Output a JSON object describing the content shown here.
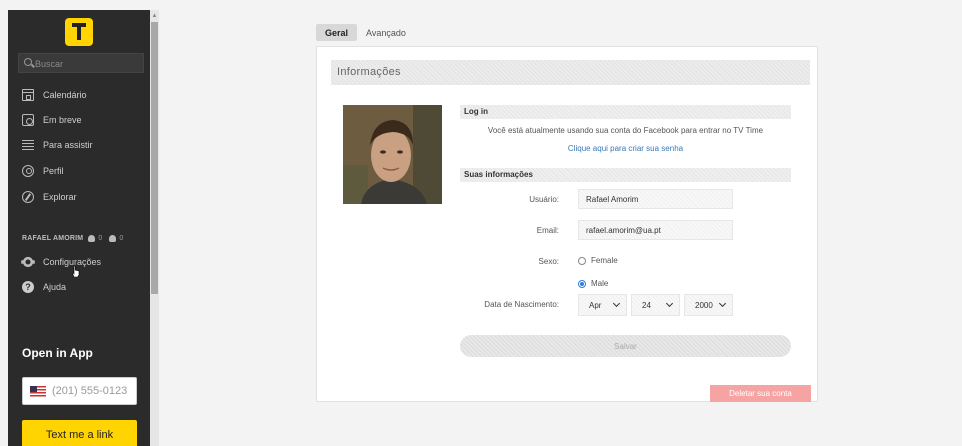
{
  "sidebar": {
    "search_placeholder": "Buscar",
    "items": [
      {
        "label": "Calendário",
        "icon": "calendar-icon"
      },
      {
        "label": "Em breve",
        "icon": "coming-soon-icon"
      },
      {
        "label": "Para assistir",
        "icon": "watchlist-icon"
      },
      {
        "label": "Perfil",
        "icon": "profile-icon"
      },
      {
        "label": "Explorar",
        "icon": "explore-icon"
      }
    ],
    "user": {
      "name": "RAFAEL AMORIM",
      "friends_count": "0",
      "notifications_count": "0"
    },
    "settings_label": "Configurações",
    "help_label": "Ajuda",
    "open_app_title": "Open in App",
    "phone_placeholder": "(201) 555-0123",
    "text_link_label": "Text me a link"
  },
  "tabs": [
    {
      "label": "Geral",
      "active": true
    },
    {
      "label": "Avançado",
      "active": false
    }
  ],
  "panel": {
    "title": "Informações",
    "login": {
      "section_title": "Log in",
      "message": "Você está atualmente usando sua conta do Facebook para entrar no TV Time",
      "create_password_link": "Clique aqui para criar sua senha"
    },
    "info": {
      "section_title": "Suas informações",
      "username_label": "Usuário:",
      "username_value": "Rafael Amorim",
      "email_label": "Email:",
      "email_value": "rafael.amorim@ua.pt",
      "gender_label": "Sexo:",
      "gender_options": [
        "Female",
        "Male"
      ],
      "gender_selected": "Male",
      "birth_label": "Data de Nascimento:",
      "birth_month": "Apr",
      "birth_day": "24",
      "birth_year": "2000"
    },
    "save_label": "Salvar",
    "delete_label": "Deletar sua conta"
  },
  "colors": {
    "sidebar_bg": "#2b2b2b",
    "brand_yellow": "#ffd400",
    "link_blue": "#3a78b8",
    "radio_blue": "#2f7fe0",
    "danger": "#f5a3a3"
  }
}
